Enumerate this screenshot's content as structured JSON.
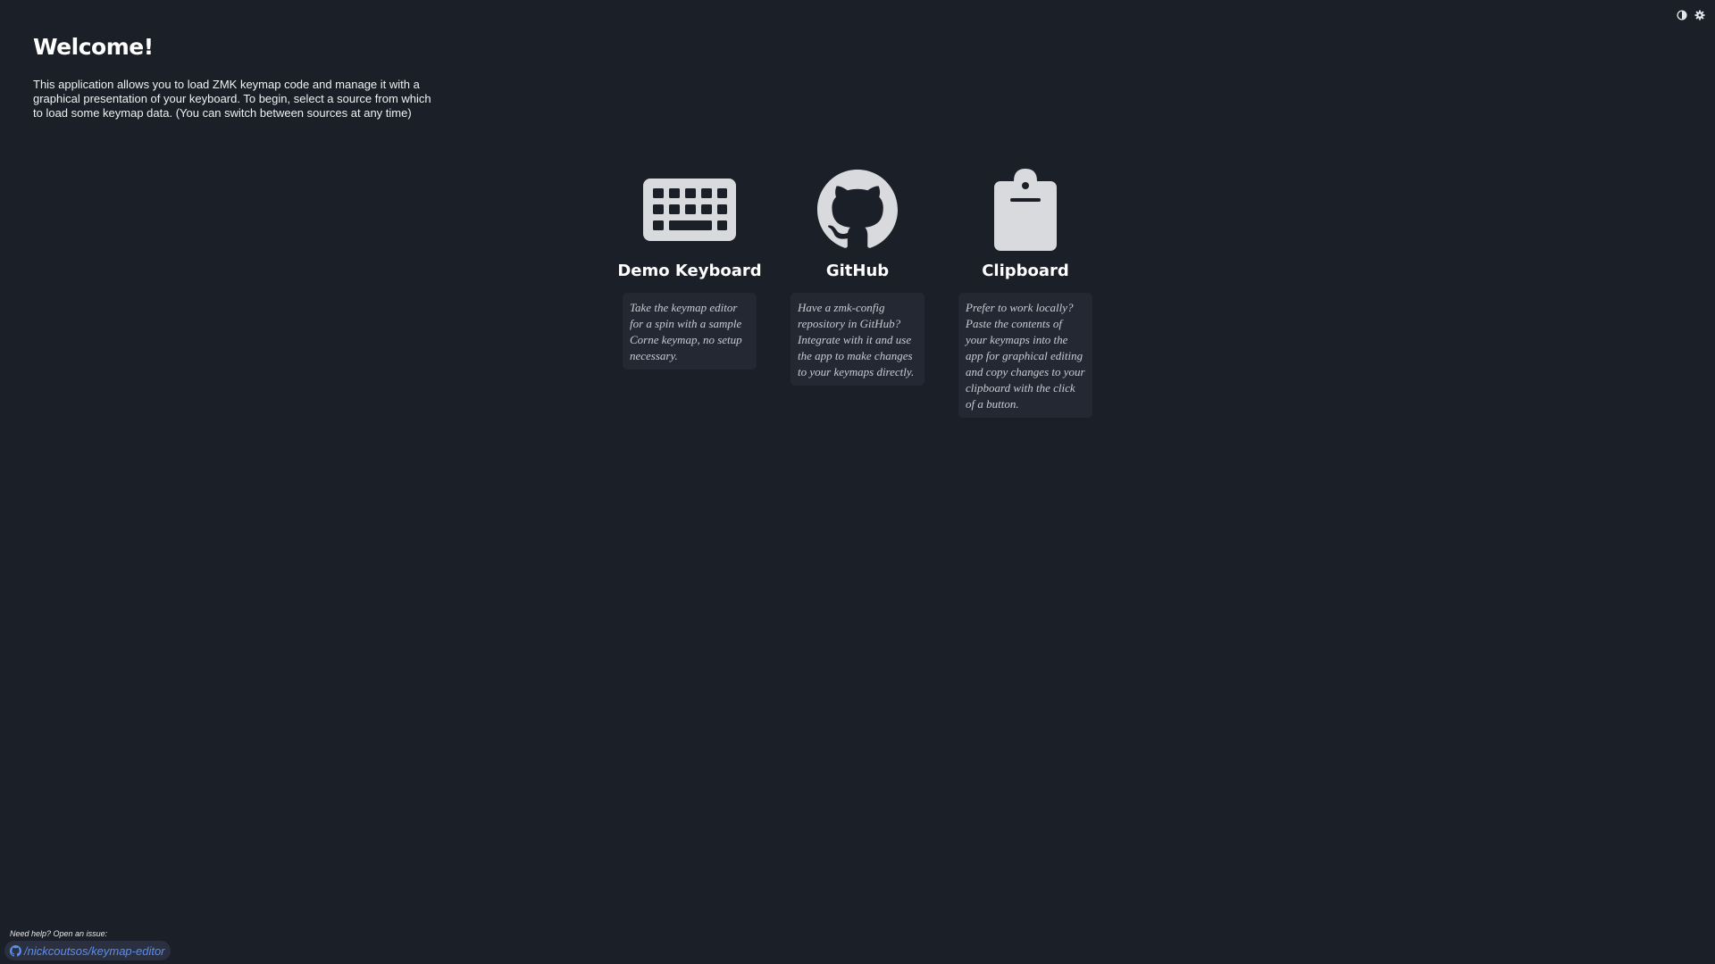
{
  "controls": {
    "theme_icon": "half-circle-contrast-icon",
    "settings_icon": "gear-icon"
  },
  "intro": {
    "title": "Welcome!",
    "description": "This application allows you to load ZMK keymap code and manage it with a graphical presentation of your keyboard. To begin, select a source from which to load some keymap data. (You can switch between sources at any time)"
  },
  "sources": [
    {
      "icon": "keyboard-icon",
      "title": "Demo Keyboard",
      "description": "Take the keymap editor for a spin with a sample Corne keymap, no setup necessary."
    },
    {
      "icon": "github-icon",
      "title": "GitHub",
      "description": "Have a zmk-config repository in GitHub? Integrate with it and use the app to make changes to your keymaps directly."
    },
    {
      "icon": "clipboard-icon",
      "title": "Clipboard",
      "description": "Prefer to work locally? Paste the contents of your keymaps into the app for graphical editing and copy changes to your clipboard with the click of a button."
    }
  ],
  "footer": {
    "help_text": "Need help? Open an issue:",
    "repo_link": "/nickcoutsos/keymap-editor",
    "repo_icon": "github-icon"
  },
  "colors": {
    "background": "#1b1f27",
    "card_background": "#232833",
    "icon_fill": "#d9dadd",
    "link": "#5b8def"
  }
}
